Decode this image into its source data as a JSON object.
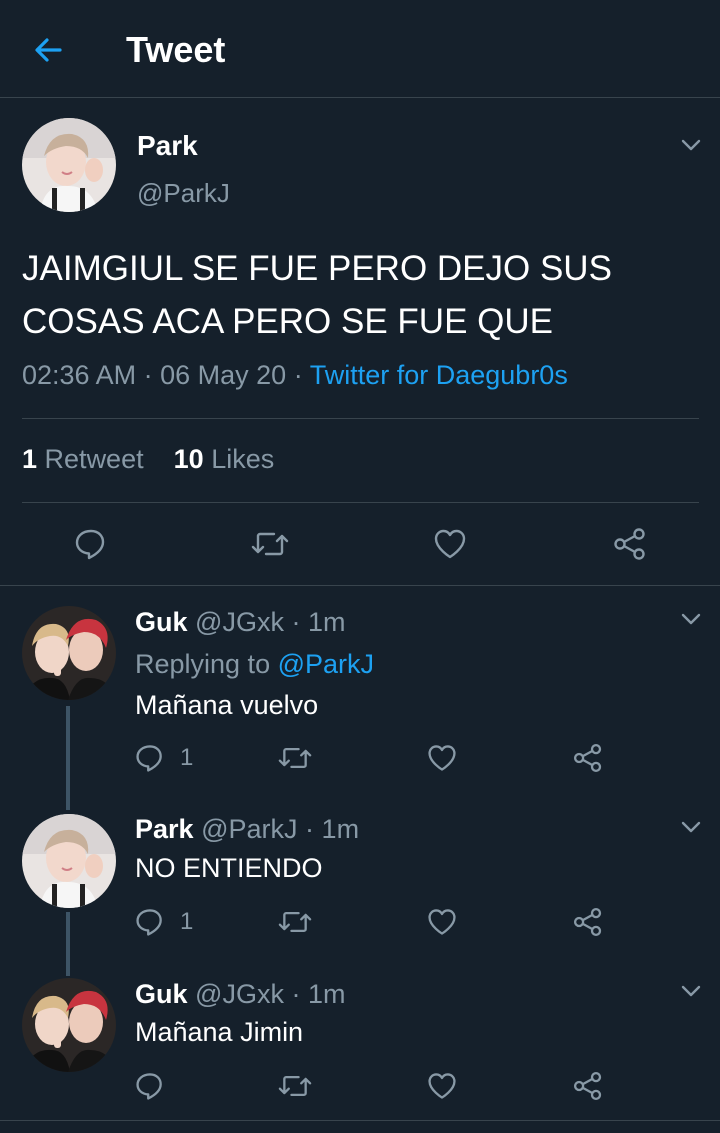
{
  "header": {
    "title": "Tweet"
  },
  "main_tweet": {
    "name": "Park",
    "handle": "@ParkJ",
    "text": "JAIMGIUL SE FUE PERO DEJO SUS COSAS ACA PERO SE FUE QUE",
    "time": "02:36 AM",
    "date": "06 May 20",
    "source": "Twitter for Daegubr0s",
    "dot": "·",
    "retweets_count": "1",
    "retweets_label": "Retweet",
    "likes_count": "10",
    "likes_label": "Likes"
  },
  "replies": [
    {
      "name": "Guk",
      "handle": "@JGxk",
      "time": "1m",
      "replying_prefix": "Replying to",
      "replying_to": "@ParkJ",
      "text": "Mañana vuelvo",
      "reply_count": "1"
    },
    {
      "name": "Park",
      "handle": "@ParkJ",
      "time": "1m",
      "text": "NO ENTIENDO",
      "reply_count": "1"
    },
    {
      "name": "Guk",
      "handle": "@JGxk",
      "time": "1m",
      "text": "Mañana Jimin",
      "reply_count": ""
    }
  ],
  "colors": {
    "background": "#15202b",
    "accent": "#1da1f2",
    "muted": "#8899a6",
    "divider": "#38444d"
  },
  "icons": [
    "back-arrow-icon",
    "chevron-down-icon",
    "reply-icon",
    "retweet-icon",
    "like-icon",
    "share-icon",
    "avatar-park",
    "avatar-guk"
  ]
}
